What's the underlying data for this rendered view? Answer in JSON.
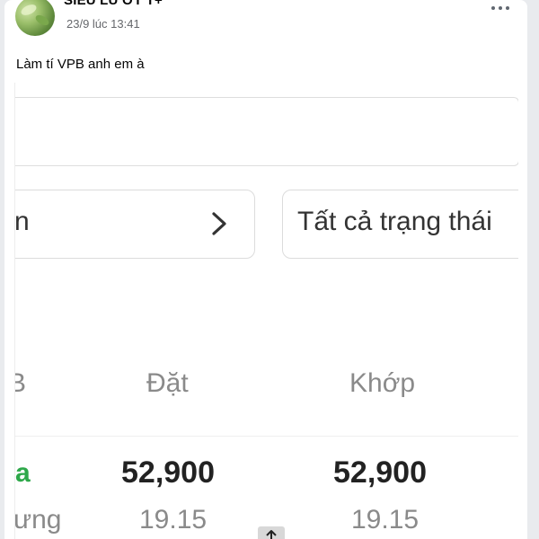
{
  "post": {
    "author": "SIÊU LŨ ỚT T+",
    "timestamp": "23/9 lúc 13:41",
    "text": "Làm tí VPB anh em à"
  },
  "embedded": {
    "filter_left_text": "n",
    "filter_right_text": "Tất cả trạng thái",
    "columns": [
      "B",
      "Đặt",
      "Khớp"
    ],
    "row": {
      "symbol_fragment": "a",
      "dat_price": "52,900",
      "khop_price": "52,900",
      "left_sub": "ưng",
      "dat_sub": "19.15",
      "khop_sub": "19.15"
    }
  },
  "icons": {
    "more": "more-horizontal-icon",
    "chevron": "chevron-right-icon",
    "scroll": "arrow-up-icon"
  },
  "colors": {
    "accent_green": "#2ea84a",
    "text_muted": "#8a8a8a"
  }
}
